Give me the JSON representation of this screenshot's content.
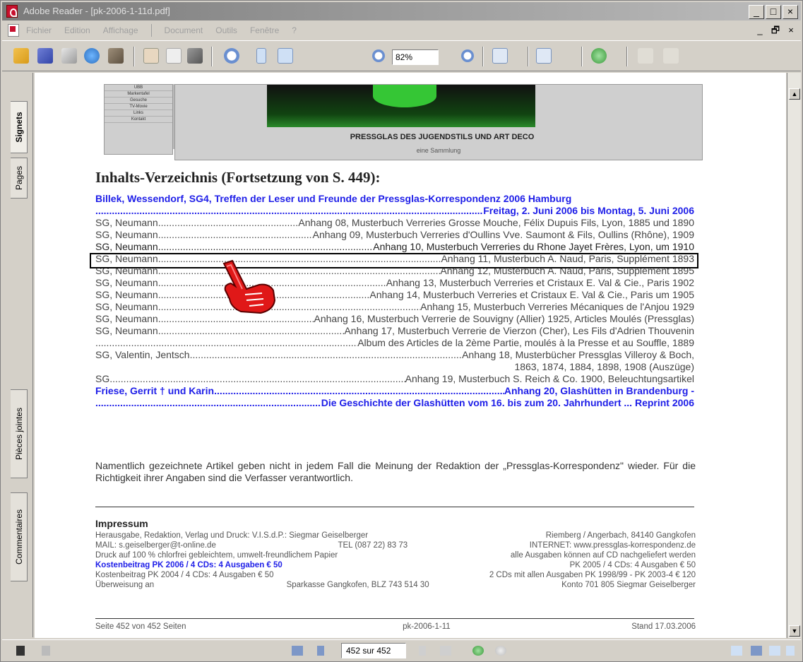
{
  "window": {
    "title": "Adobe Reader - [pk-2006-1-11d.pdf]",
    "controls": [
      "_",
      "□",
      "×"
    ],
    "doc_controls": [
      "_",
      "🗗",
      "×"
    ]
  },
  "menubar": {
    "items": [
      "Fichier",
      "Edition",
      "Affichage",
      "Document",
      "Outils",
      "Fenêtre",
      "?"
    ]
  },
  "toolbar": {
    "zoom_value": "82%",
    "icons": [
      "open-icon",
      "save-icon",
      "print-icon",
      "email-icon",
      "search-icon",
      "hand-tool-icon",
      "select-text-icon",
      "snapshot-icon",
      "zoom-in-icon",
      "fit-page-icon",
      "fit-width-icon",
      "zoom-out-minus-icon",
      "zoom-in-plus-icon",
      "rotate-icon",
      "pages-view-icon",
      "help-icon",
      "back-icon",
      "forward-icon"
    ]
  },
  "nav_tabs": {
    "signets": "Signets",
    "pages": "Pages",
    "pieces_jointes": "Pièces jointes",
    "commentaires": "Commentaires"
  },
  "banner": {
    "nav_items": [
      "UBB",
      "Markentafel",
      "Gesuche",
      "TV-Movie",
      "Links",
      "Kontakt"
    ],
    "title": "PRESSGLAS DES JUGENDSTILS UND ART DECO",
    "subtitle": "eine Sammlung"
  },
  "toc": {
    "title": "Inhalts-Verzeichnis (Fortsetzung von S. 449):",
    "lines": [
      {
        "left": "Billek, Wessendorf, SG4, Treffen der Leser und Freunde der Pressglas-Korrespondenz 2006 Hamburg",
        "right": "",
        "style": "blue-full"
      },
      {
        "left": "",
        "right": "Freitag, 2. Juni 2006 bis Montag, 5. Juni 2006",
        "style": "blue"
      },
      {
        "left": "SG, Neumann",
        "right": "Anhang 08, Musterbuch Verreries Grosse Mouche, Félix Dupuis Fils, Lyon, 1885 und 1890",
        "style": "normal"
      },
      {
        "left": "SG, Neumann",
        "right": "Anhang 09, Musterbuch Verreries d'Oullins Vve. Saumont & Fils, Oullins (Rhône), 1909",
        "style": "normal"
      },
      {
        "left": "SG, Neumann",
        "right": "Anhang 10, Musterbuch Verreries du Rhone Jayet Frères, Lyon, um 1910",
        "style": "highlight"
      },
      {
        "left": "SG, Neumann",
        "right": "Anhang 11, Musterbuch A. Naud, Paris, Supplément 1893",
        "style": "normal"
      },
      {
        "left": "SG, Neumann",
        "right": "Anhang 12, Musterbuch A. Naud, Paris, Supplément 1895",
        "style": "normal"
      },
      {
        "left": "SG, Neumann",
        "right": "Anhang 13, Musterbuch Verreries et Cristaux E. Val & Cie., Paris 1902",
        "style": "normal"
      },
      {
        "left": "SG, Neumann",
        "right": "Anhang 14, Musterbuch Verreries et Cristaux E. Val & Cie., Paris um 1905",
        "style": "normal"
      },
      {
        "left": "SG, Neumann",
        "right": "Anhang 15, Musterbuch Verreries Mécaniques de l'Anjou 1929",
        "style": "normal"
      },
      {
        "left": "SG, Neumann",
        "right": "Anhang 16, Musterbuch Verrerie de Souvigny (Allier) 1925, Articles Moulés (Pressglas)",
        "style": "normal"
      },
      {
        "left": "SG, Neumann",
        "right": "Anhang 17, Musterbuch Verrerie de Vierzon (Cher), Les Fils d'Adrien Thouvenin",
        "style": "normal"
      },
      {
        "left": "",
        "right": "Album des Articles de la 2ème Partie, moulés à la Presse et au Souffle, 1889",
        "style": "normal"
      },
      {
        "left": "SG, Valentin, Jentsch",
        "right": "Anhang 18, Musterbücher Pressglas Villeroy & Boch,",
        "style": "normal"
      },
      {
        "left": "",
        "right": "1863, 1874, 1884, 1898, 1908 (Auszüge)",
        "style": "right-only"
      },
      {
        "left": "SG",
        "right": "Anhang 19, Musterbuch S. Reich & Co. 1900, Beleuchtungsartikel",
        "style": "normal"
      },
      {
        "left": "Friese, Gerrit † und Karin",
        "right": "Anhang 20, Glashütten in Brandenburg -",
        "style": "blue"
      },
      {
        "left": "",
        "right": "Die Geschichte der Glashütten vom 16. bis zum 20. Jahrhundert ... Reprint 2006",
        "style": "blue"
      }
    ],
    "note": "Namentlich gezeichnete Artikel geben nicht in jedem Fall die Meinung der Redaktion der „Pressglas-Korrespondenz\" wieder. Für die Richtigkeit ihrer Angaben sind die Verfasser verantwortlich."
  },
  "impressum": {
    "title": "Impressum",
    "lines": [
      {
        "l": "Herausgabe, Redaktion, Verlag und Druck: V.I.S.d.P.: Siegmar Geiselberger",
        "r": "Riemberg / Angerbach, 84140 Gangkofen",
        "blue": false
      },
      {
        "l": "MAIL: s.geiselberger@t-online.de",
        "m": "TEL (087 22) 83 73",
        "r": "INTERNET: www.pressglas-korrespondenz.de",
        "blue": false
      },
      {
        "l": "Druck auf 100 % chlorfrei gebleichtem, umwelt-freundlichem Papier",
        "r": "alle Ausgaben können auf CD nachgeliefert werden",
        "blue": false
      },
      {
        "l": "Kostenbeitrag PK 2006 / 4 CDs: 4 Ausgaben € 50",
        "r": "PK 2005 / 4 CDs: 4 Ausgaben € 50",
        "blue": true
      },
      {
        "l": "Kostenbeitrag PK 2004 / 4 CDs: 4 Ausgaben € 50",
        "r": "2 CDs mit allen Ausgaben PK 1998/99 - PK 2003-4 € 120",
        "blue": false
      },
      {
        "l": "Überweisung an",
        "m": "Sparkasse Gangkofen, BLZ 743 514 30",
        "r": "Konto 701 805 Siegmar Geiselberger",
        "blue": false
      }
    ]
  },
  "footer": {
    "left": "Seite 452 von 452 Seiten",
    "center": "pk-2006-1-11",
    "right": "Stand 17.03.2006"
  },
  "statusbar": {
    "page_indicator": "452 sur 452"
  }
}
